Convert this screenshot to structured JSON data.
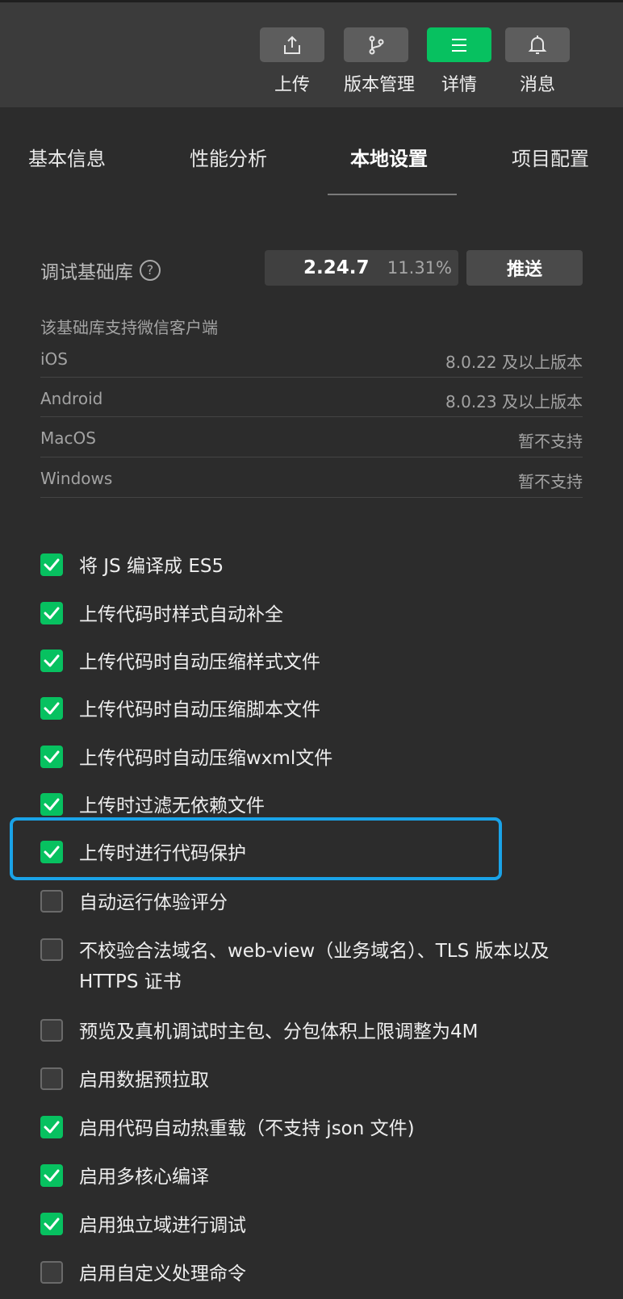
{
  "toolbar": {
    "buttons": [
      {
        "label": "上传",
        "icon": "upload-icon",
        "active": false
      },
      {
        "label": "版本管理",
        "icon": "branch-icon",
        "active": false
      },
      {
        "label": "详情",
        "icon": "menu-icon",
        "active": true
      },
      {
        "label": "消息",
        "icon": "bell-icon",
        "active": false
      }
    ]
  },
  "tabs": [
    {
      "label": "基本信息"
    },
    {
      "label": "性能分析"
    },
    {
      "label": "本地设置"
    },
    {
      "label": "项目配置"
    }
  ],
  "base_lib": {
    "label": "调试基础库",
    "help": "?",
    "version": "2.24.7",
    "percent": "11.31%",
    "push_label": "推送"
  },
  "support": {
    "title": "该基础库支持微信客户端",
    "rows": [
      {
        "os": "iOS",
        "version": "8.0.22 及以上版本"
      },
      {
        "os": "Android",
        "version": "8.0.23 及以上版本"
      },
      {
        "os": "MacOS",
        "version": "暂不支持"
      },
      {
        "os": "Windows",
        "version": "暂不支持"
      }
    ]
  },
  "options": [
    {
      "label": "将 JS 编译成 ES5",
      "checked": true
    },
    {
      "label": "上传代码时样式自动补全",
      "checked": true
    },
    {
      "label": "上传代码时自动压缩样式文件",
      "checked": true
    },
    {
      "label": "上传代码时自动压缩脚本文件",
      "checked": true
    },
    {
      "label": "上传代码时自动压缩wxml文件",
      "checked": true
    },
    {
      "label": "上传时过滤无依赖文件",
      "checked": true
    },
    {
      "label": "上传时进行代码保护",
      "checked": true
    },
    {
      "label": "自动运行体验评分",
      "checked": false
    },
    {
      "label": "不校验合法域名、web-view（业务域名）、TLS 版本以及 HTTPS 证书",
      "checked": false
    },
    {
      "label": "预览及真机调试时主包、分包体积上限调整为4M",
      "checked": false
    },
    {
      "label": "启用数据预拉取",
      "checked": false
    },
    {
      "label": "启用代码自动热重载（不支持 json 文件)",
      "checked": true
    },
    {
      "label": "启用多核心编译",
      "checked": true
    },
    {
      "label": "启用独立域进行调试",
      "checked": true
    },
    {
      "label": "启用自定义处理命令",
      "checked": false
    }
  ],
  "colors": {
    "accent": "#07c160",
    "highlight": "#1aa3e8",
    "background": "#2c2c2c"
  }
}
